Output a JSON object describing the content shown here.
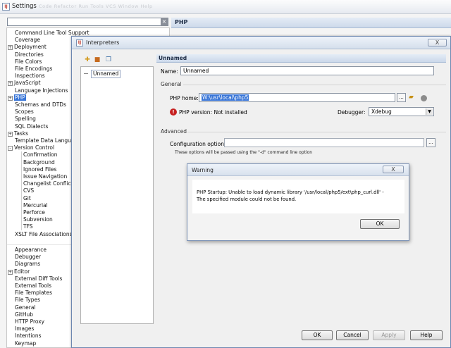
{
  "settings": {
    "title": "Settings",
    "menu_ghost": "Code  Refactor  Run  Tools  VCS  Window  Help",
    "right_header": "PHP",
    "tree": [
      {
        "label": "Command Line Tool Support",
        "depth": 0,
        "expander": ""
      },
      {
        "label": "Coverage",
        "depth": 0,
        "expander": ""
      },
      {
        "label": "Deployment",
        "depth": 0,
        "expander": "+"
      },
      {
        "label": "Directories",
        "depth": 0,
        "expander": ""
      },
      {
        "label": "File Colors",
        "depth": 0,
        "expander": ""
      },
      {
        "label": "File Encodings",
        "depth": 0,
        "expander": ""
      },
      {
        "label": "Inspections",
        "depth": 0,
        "expander": ""
      },
      {
        "label": "JavaScript",
        "depth": 0,
        "expander": "+"
      },
      {
        "label": "Language Injections",
        "depth": 0,
        "expander": ""
      },
      {
        "label": "PHP",
        "depth": 0,
        "expander": "+",
        "selected": true
      },
      {
        "label": "Schemas and DTDs",
        "depth": 0,
        "expander": ""
      },
      {
        "label": "Scopes",
        "depth": 0,
        "expander": ""
      },
      {
        "label": "Spelling",
        "depth": 0,
        "expander": ""
      },
      {
        "label": "SQL Dialects",
        "depth": 0,
        "expander": ""
      },
      {
        "label": "Tasks",
        "depth": 0,
        "expander": "+"
      },
      {
        "label": "Template Data Languages",
        "depth": 0,
        "expander": ""
      },
      {
        "label": "Version Control",
        "depth": 0,
        "expander": "-"
      },
      {
        "label": "Confirmation",
        "depth": 1,
        "expander": ""
      },
      {
        "label": "Background",
        "depth": 1,
        "expander": ""
      },
      {
        "label": "Ignored Files",
        "depth": 1,
        "expander": ""
      },
      {
        "label": "Issue Navigation",
        "depth": 1,
        "expander": ""
      },
      {
        "label": "Changelist Conflicts",
        "depth": 1,
        "expander": ""
      },
      {
        "label": "CVS",
        "depth": 1,
        "expander": ""
      },
      {
        "label": "Git",
        "depth": 1,
        "expander": ""
      },
      {
        "label": "Mercurial",
        "depth": 1,
        "expander": ""
      },
      {
        "label": "Perforce",
        "depth": 1,
        "expander": ""
      },
      {
        "label": "Subversion",
        "depth": 1,
        "expander": ""
      },
      {
        "label": "TFS",
        "depth": 1,
        "expander": ""
      },
      {
        "label": "XSLT File Associations",
        "depth": 0,
        "expander": ""
      }
    ],
    "tree_ide": [
      {
        "label": "Appearance",
        "expander": ""
      },
      {
        "label": "Debugger",
        "expander": ""
      },
      {
        "label": "Diagrams",
        "expander": ""
      },
      {
        "label": "Editor",
        "expander": "+"
      },
      {
        "label": "External Diff Tools",
        "expander": ""
      },
      {
        "label": "External Tools",
        "expander": ""
      },
      {
        "label": "File Templates",
        "expander": ""
      },
      {
        "label": "File Types",
        "expander": ""
      },
      {
        "label": "General",
        "expander": ""
      },
      {
        "label": "GitHub",
        "expander": ""
      },
      {
        "label": "HTTP Proxy",
        "expander": ""
      },
      {
        "label": "Images",
        "expander": ""
      },
      {
        "label": "Intentions",
        "expander": ""
      },
      {
        "label": "Keymap",
        "expander": ""
      }
    ]
  },
  "interpreters": {
    "title": "Interpreters",
    "close_label": "X",
    "list_item": "Unnamed",
    "detail_header": "Unnamed",
    "name_label": "Name:",
    "name_value": "Unnamed",
    "general_label": "General",
    "php_home_label": "PHP home:",
    "php_home_value": "W:\\usr\\local\\php5",
    "browse_label": "...",
    "php_version": "PHP version: Not installed",
    "debugger_label": "Debugger:",
    "debugger_value": "Xdebug",
    "advanced_label": "Advanced",
    "config_label": "Configuration options:",
    "config_value": "",
    "config_hint": "These options will be passed using the \"-d\" command line option",
    "buttons": {
      "ok": "OK",
      "cancel": "Cancel",
      "apply": "Apply",
      "help": "Help"
    }
  },
  "warning": {
    "title": "Warning",
    "close_label": "X",
    "message_line1": "PHP Startup: Unable to load dynamic library '/usr/local/php5/ext\\php_curl.dll' -",
    "message_line2": "The specified module could not be found.",
    "ok": "OK"
  },
  "colors": {
    "selection": "#3875d7",
    "error": "#c62020",
    "header": "#cdd9ea"
  }
}
